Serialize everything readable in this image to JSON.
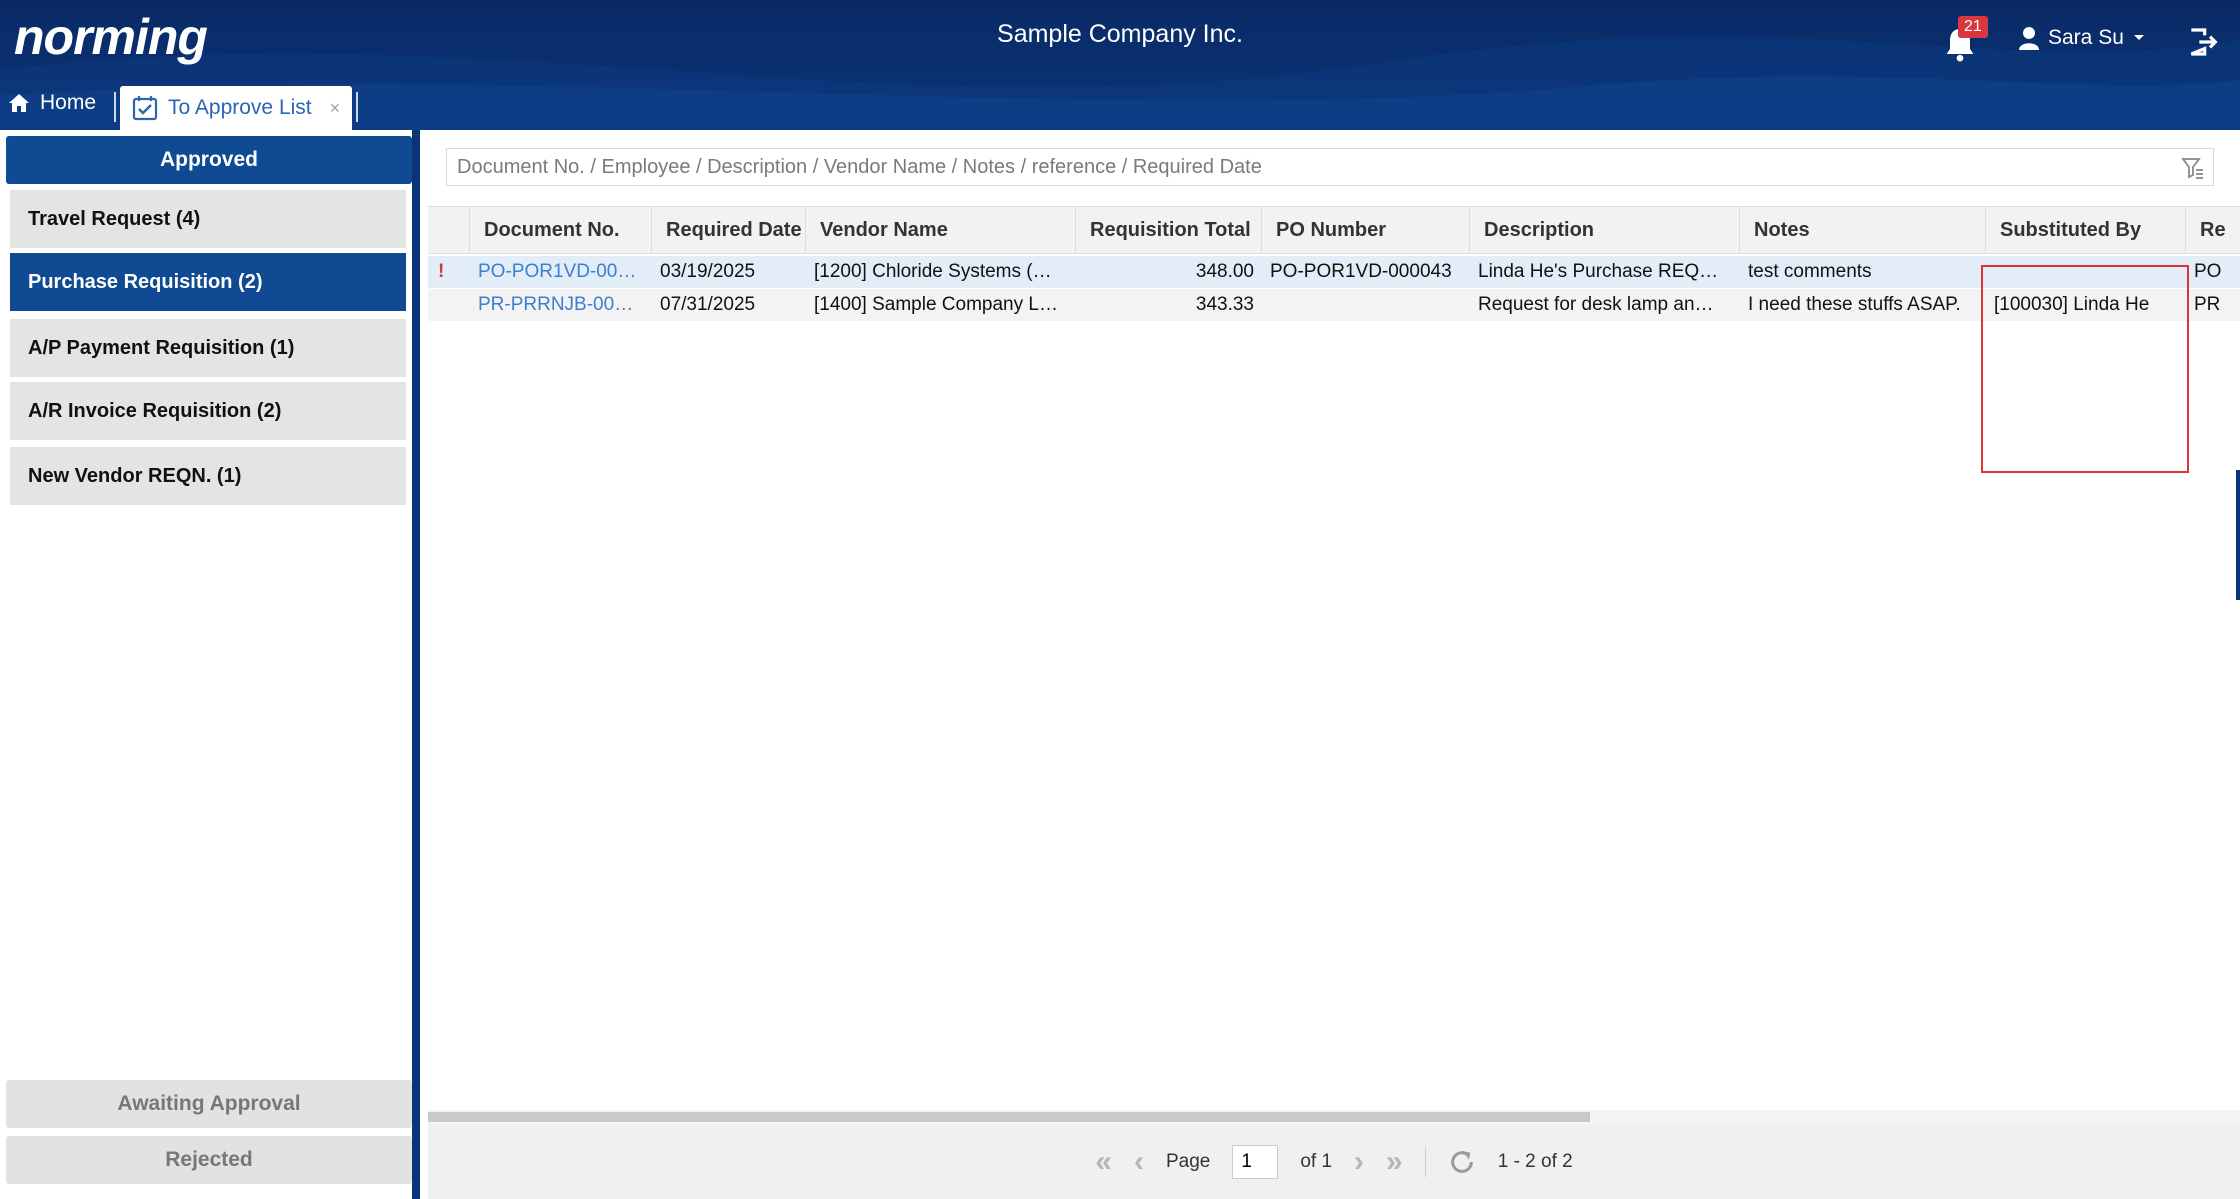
{
  "header": {
    "logo": "norming",
    "company": "Sample Company Inc.",
    "notification_count": "21",
    "user_name": "Sara Su"
  },
  "tabs": [
    {
      "label": "Home",
      "icon": "home-icon"
    },
    {
      "label": "To Approve List",
      "icon": "calendar-check-icon",
      "close": "×"
    }
  ],
  "sidebar": {
    "head": "Approved",
    "items": [
      {
        "label": "Travel Request (4)"
      },
      {
        "label": "Purchase Requisition (2)",
        "active": true
      },
      {
        "label": "A/P Payment Requisition (1)"
      },
      {
        "label": "A/R Invoice Requisition (2)"
      },
      {
        "label": "New Vendor REQN. (1)"
      }
    ],
    "footer": [
      "Awaiting Approval",
      "Rejected"
    ]
  },
  "search": {
    "placeholder": "Document No. / Employee / Description / Vendor Name / Notes / reference / Required Date"
  },
  "grid": {
    "columns": [
      "Document No.",
      "Required Date",
      "Vendor Name",
      "Requisition Total",
      "PO Number",
      "Description",
      "Notes",
      "Substituted By",
      "Re"
    ],
    "rows": [
      {
        "flag": "!",
        "document_no": "PO-POR1VD-00…",
        "required_date": "03/19/2025",
        "vendor_name": "[1200] Chloride Systems (…",
        "requisition_total": "348.00",
        "po_number": "PO-POR1VD-000043",
        "description": "Linda He's Purchase REQ…",
        "notes": "test comments",
        "substituted_by": "",
        "ref": "PO"
      },
      {
        "flag": "",
        "document_no": "PR-PRRNJB-00…",
        "required_date": "07/31/2025",
        "vendor_name": "[1400] Sample Company L…",
        "requisition_total": "343.33",
        "po_number": "",
        "description": "Request for desk lamp an…",
        "notes": "I need these stuffs ASAP.",
        "substituted_by": "[100030] Linda He",
        "ref": "PR"
      }
    ]
  },
  "pager": {
    "page_label": "Page",
    "page_value": "1",
    "of_label": "of 1",
    "range": "1 - 2 of 2"
  },
  "colors": {
    "header_bg": "#0a2a66",
    "accent": "#0f4a92",
    "link": "#3b7fd0",
    "badge": "#d9363e",
    "highlight_box": "#e0323a"
  }
}
